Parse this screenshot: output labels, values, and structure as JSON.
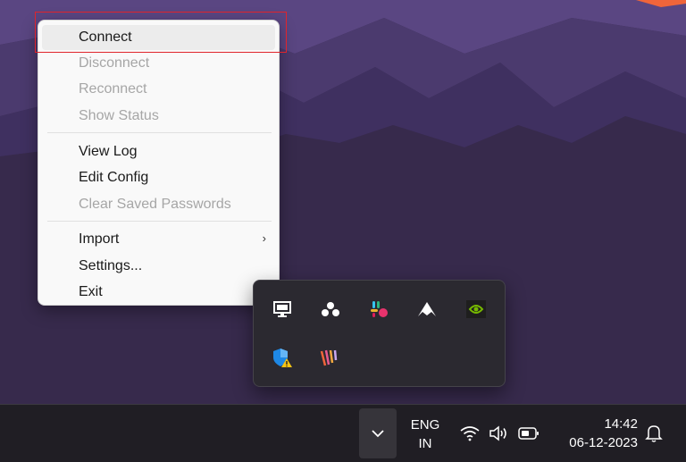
{
  "context_menu": {
    "items": [
      {
        "label": "Connect",
        "enabled": true
      },
      {
        "label": "Disconnect",
        "enabled": false
      },
      {
        "label": "Reconnect",
        "enabled": false
      },
      {
        "label": "Show Status",
        "enabled": false
      },
      {
        "label": "View Log",
        "enabled": true
      },
      {
        "label": "Edit Config",
        "enabled": true
      },
      {
        "label": "Clear Saved Passwords",
        "enabled": false
      },
      {
        "label": "Import",
        "enabled": true,
        "submenu": true
      },
      {
        "label": "Settings...",
        "enabled": true
      },
      {
        "label": "Exit",
        "enabled": true
      }
    ],
    "submenu_arrow": "›"
  },
  "tray_overflow": {
    "icons": [
      "monitor-icon",
      "dots-cluster-icon",
      "slack-icon",
      "nordvpn-icon",
      "nvidia-icon",
      "security-shield-warning-icon",
      "stripes-app-icon"
    ]
  },
  "taskbar": {
    "language_line1": "ENG",
    "language_line2": "IN",
    "time": "14:42",
    "date": "06-12-2023"
  },
  "colors": {
    "highlight": "#e0242b",
    "menu_bg": "#f9f9f9",
    "taskbar_bg": "#201e24",
    "accent_orange": "#f0653a"
  }
}
